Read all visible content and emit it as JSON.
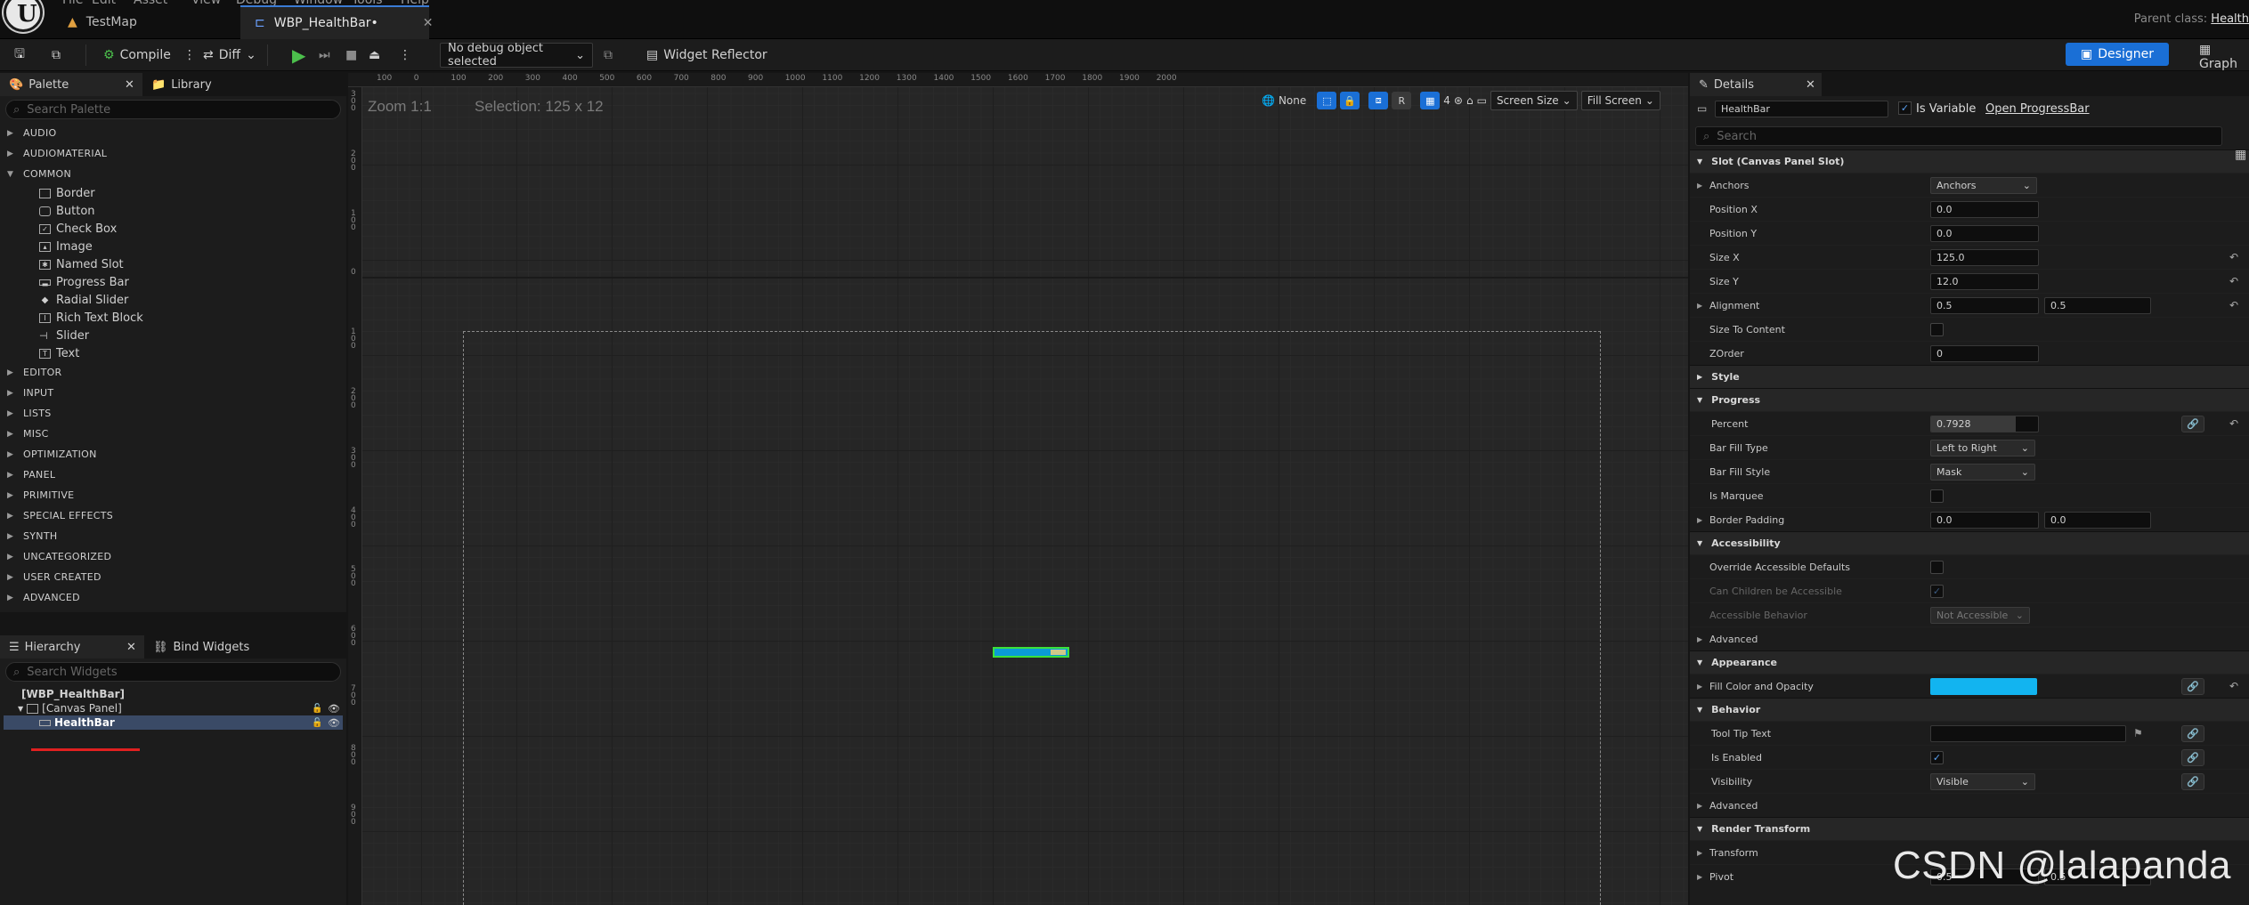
{
  "menu": [
    "File",
    "Edit",
    "Asset",
    "View",
    "Debug",
    "Window",
    "Tools",
    "Help"
  ],
  "tabs": [
    {
      "label": "TestMap"
    },
    {
      "label": "WBP_HealthBar•"
    }
  ],
  "parent_class": {
    "label": "Parent class:",
    "value": "Health"
  },
  "toolbar": {
    "compile": "Compile",
    "diff": "Diff",
    "debug_object": "No debug object selected",
    "widget_reflector": "Widget Reflector",
    "designer": "Designer",
    "graph": "Graph"
  },
  "palette": {
    "tab": "Palette",
    "library_tab": "Library",
    "search_placeholder": "Search Palette",
    "categories_top": [
      "AUDIO",
      "AUDIOMATERIAL",
      "COMMON"
    ],
    "common_items": [
      "Border",
      "Button",
      "Check Box",
      "Image",
      "Named Slot",
      "Progress Bar",
      "Radial Slider",
      "Rich Text Block",
      "Slider",
      "Text"
    ],
    "categories_bottom": [
      "EDITOR",
      "INPUT",
      "LISTS",
      "MISC",
      "OPTIMIZATION",
      "PANEL",
      "PRIMITIVE",
      "SPECIAL EFFECTS",
      "SYNTH",
      "UNCATEGORIZED",
      "USER CREATED",
      "ADVANCED"
    ]
  },
  "hierarchy": {
    "tab": "Hierarchy",
    "bind_tab": "Bind Widgets",
    "search_placeholder": "Search Widgets",
    "root": "[WBP_HealthBar]",
    "canvas": "[Canvas Panel]",
    "selected": "HealthBar"
  },
  "canvas": {
    "zoom": "Zoom 1:1",
    "selection": "Selection: 125 x 12",
    "ruler_top": [
      "100",
      "0",
      "100",
      "200",
      "300",
      "400",
      "500",
      "600",
      "700",
      "800",
      "900",
      "1000",
      "1100",
      "1200",
      "1300",
      "1400",
      "1500",
      "1600",
      "1700",
      "1800",
      "1900",
      "2000"
    ],
    "ruler_left": [
      "300",
      "200",
      "100",
      "0",
      "100",
      "200",
      "300",
      "400",
      "500",
      "600",
      "700",
      "800",
      "900"
    ],
    "tools": {
      "none": "None",
      "r": "R",
      "grid_count": "4",
      "screen_size": "Screen Size",
      "fill_screen": "Fill Screen"
    },
    "progress_percent": 0.7928
  },
  "details": {
    "tab": "Details",
    "widget_name": "HealthBar",
    "is_variable": "Is Variable",
    "open_link": "Open ProgressBar",
    "search_placeholder": "Search",
    "sections": {
      "slot": "Slot (Canvas Panel Slot)",
      "style": "Style",
      "progress": "Progress",
      "accessibility": "Accessibility",
      "appearance": "Appearance",
      "behavior": "Behavior",
      "render_transform": "Render Transform"
    },
    "slot": {
      "anchors_label": "Anchors",
      "anchors_value": "Anchors",
      "pos_x_label": "Position X",
      "pos_x": "0.0",
      "pos_y_label": "Position Y",
      "pos_y": "0.0",
      "size_x_label": "Size X",
      "size_x": "125.0",
      "size_y_label": "Size Y",
      "size_y": "12.0",
      "alignment_label": "Alignment",
      "align_x": "0.5",
      "align_y": "0.5",
      "size_to_content_label": "Size To Content",
      "zorder_label": "ZOrder",
      "zorder": "0"
    },
    "progress": {
      "percent_label": "Percent",
      "percent": "0.7928",
      "fill_type_label": "Bar Fill Type",
      "fill_type": "Left to Right",
      "fill_style_label": "Bar Fill Style",
      "fill_style": "Mask",
      "marquee_label": "Is Marquee",
      "border_padding_label": "Border Padding",
      "pad_x": "0.0",
      "pad_y": "0.0"
    },
    "accessibility": {
      "override_label": "Override Accessible Defaults",
      "children_label": "Can Children be Accessible",
      "behavior_label": "Accessible Behavior",
      "behavior_value": "Not Accessible",
      "advanced_label": "Advanced"
    },
    "appearance": {
      "fill_label": "Fill Color and Opacity",
      "fill_color": "#12b4f0"
    },
    "behavior": {
      "tooltip_label": "Tool Tip Text",
      "enabled_label": "Is Enabled",
      "visibility_label": "Visibility",
      "visibility": "Visible",
      "advanced_label": "Advanced"
    },
    "render_transform": {
      "transform_label": "Transform",
      "pivot_label": "Pivot",
      "pivot_x": "0.5",
      "pivot_y": "0.5"
    }
  },
  "watermark": "CSDN @lalapanda",
  "colors": {
    "accent": "#1a6fd6",
    "selection_green": "#3be03b",
    "bar_blue": "#0a9bd6",
    "annotation_red": "#e02020"
  }
}
